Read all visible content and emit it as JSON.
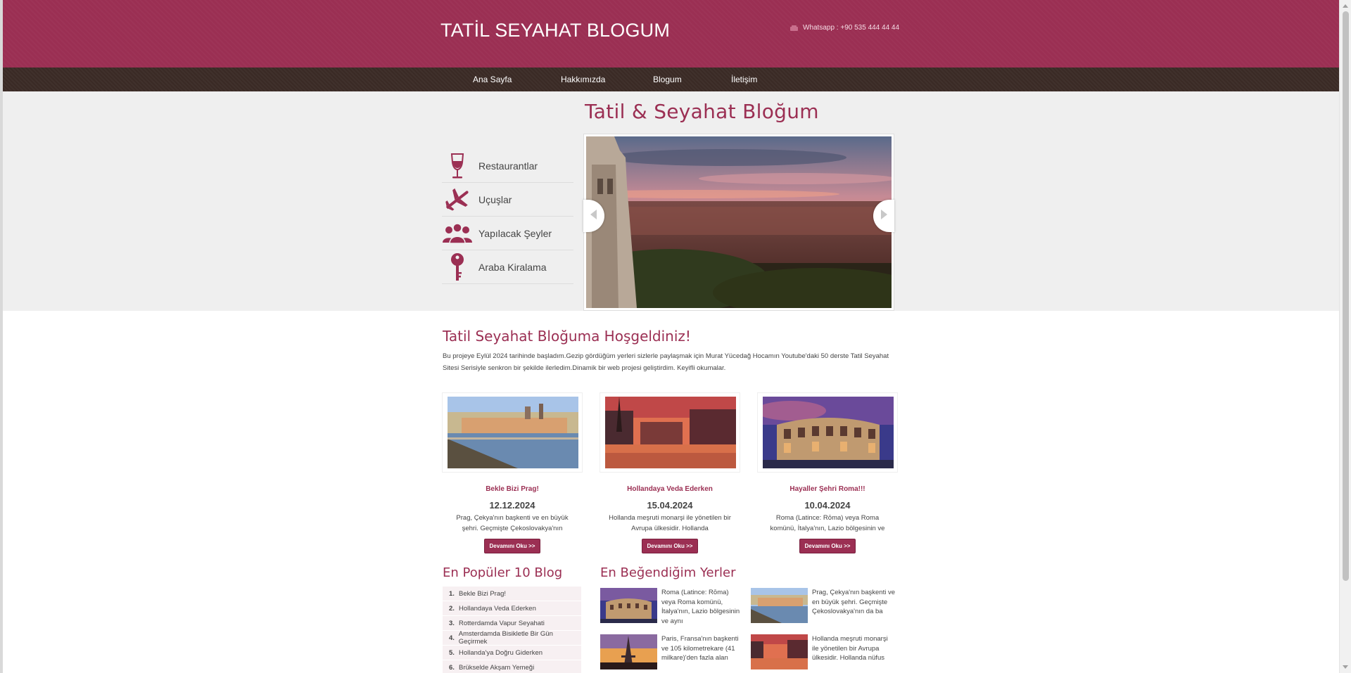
{
  "header": {
    "site_title": "TATİL SEYAHAT BLOGUM",
    "contact_text": "Whatsapp : +90 535 444 44 44"
  },
  "nav": {
    "items": [
      {
        "label": "Ana Sayfa"
      },
      {
        "label": "Hakkımızda"
      },
      {
        "label": "Blogum"
      },
      {
        "label": "İletişim"
      }
    ]
  },
  "hero": {
    "title": "Tatil & Seyahat Bloğum",
    "categories": [
      {
        "label": "Restaurantlar",
        "icon": "wine-glass-icon"
      },
      {
        "label": "Uçuşlar",
        "icon": "airplane-icon"
      },
      {
        "label": "Yapılacak Şeyler",
        "icon": "people-icon"
      },
      {
        "label": "Araba Kiralama",
        "icon": "key-icon"
      }
    ]
  },
  "welcome": {
    "title": "Tatil Seyahat Bloğuma Hoşgeldiniz!",
    "text": "Bu projeye Eylül 2024 tarihinde başladım.Gezip gördüğüm yerleri sizlerle paylaşmak için Murat Yücedağ Hocamın Youtube'daki 50 derste Tatil Seyahat Sitesi Serisiyle senkron bir şekilde ilerledim.Dinamik bir web projesi geliştirdim. Keyifli okumalar."
  },
  "cards": [
    {
      "title": "Bekle Bizi Prag!",
      "date": "12.12.2024",
      "excerpt": "Prag, Çekya'nın başkenti ve en büyük şehri. Geçmişte Çekoslovakya'nın",
      "button": "Devamını Oku >>"
    },
    {
      "title": "Hollandaya Veda Ederken",
      "date": "15.04.2024",
      "excerpt": "Hollanda meşruti monarşi ile yönetilen bir Avrupa ülkesidir. Hollanda",
      "button": "Devamını Oku >>"
    },
    {
      "title": "Hayaller Şehri Roma!!!",
      "date": "10.04.2024",
      "excerpt": "Roma (Latince: Rōma) veya Roma komünü, İtalya'nın, Lazio bölgesinin ve",
      "button": "Devamını Oku >>"
    }
  ],
  "popular": {
    "title": "En Popüler 10 Blog",
    "items": [
      {
        "num": "1.",
        "label": "Bekle Bizi Prag!"
      },
      {
        "num": "2.",
        "label": "Hollandaya Veda Ederken"
      },
      {
        "num": "3.",
        "label": "Rotterdamda Vapur Seyahati"
      },
      {
        "num": "4.",
        "label": "Amsterdamda Bisikletle Bir Gün Geçirmek"
      },
      {
        "num": "5.",
        "label": "Hollanda'ya Doğru Giderken"
      },
      {
        "num": "6.",
        "label": "Brükselde Akşam Yemeği"
      }
    ]
  },
  "favorites": {
    "title": "En Beğendiğim Yerler",
    "items": [
      {
        "text": "Roma (Latince: Rōma) veya Roma komünü, İtalya'nın, Lazio bölgesinin ve aynı"
      },
      {
        "text": "Prag, Çekya'nın başkenti ve en büyük şehri. Geçmişte Çekoslovakya'nın da ba"
      },
      {
        "text": "Paris, Fransa'nın başkenti ve 105 kilometrekare (41 milkare)'den fazla alan"
      },
      {
        "text": "Hollanda meşruti monarşi ile yönetilen bir Avrupa ülkesidir. Hollanda nüfus"
      }
    ]
  },
  "colors": {
    "brand": "#9b2f53",
    "nav_bg": "#3a2a25",
    "hero_bg": "#efefef"
  }
}
